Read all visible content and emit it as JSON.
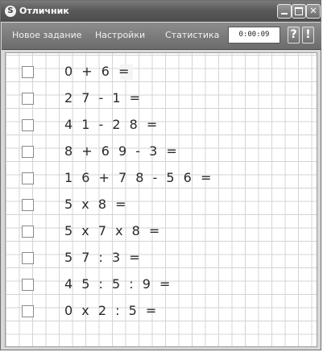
{
  "window": {
    "title": "Отличник",
    "icon": "app-logo-icon"
  },
  "toolbar": {
    "new_task_label": "Новое задание",
    "settings_label": "Настройки",
    "stats_label": "Статистика",
    "timer_value": "0:00:09",
    "help_label": "?",
    "alert_label": "!"
  },
  "problems": [
    {
      "expression": "0 + 6 =",
      "checked": false
    },
    {
      "expression": "2 7 - 1 =",
      "checked": false
    },
    {
      "expression": "4 1 - 2 8 =",
      "checked": false
    },
    {
      "expression": "8 + 6 9 - 3 =",
      "checked": false
    },
    {
      "expression": "1 6 + 7 8 - 5 6 =",
      "checked": false
    },
    {
      "expression": "5 x 8 =",
      "checked": false
    },
    {
      "expression": "5 x 7 x 8 =",
      "checked": false
    },
    {
      "expression": "5 7 : 3 =",
      "checked": false
    },
    {
      "expression": "4 5 : 5 : 9 =",
      "checked": false
    },
    {
      "expression": "0 x 2 : 5 =",
      "checked": false
    }
  ],
  "colors": {
    "titlebar": "#5a5a5a",
    "grid_line": "#d4d4d4",
    "text": "#2a2a2a"
  }
}
